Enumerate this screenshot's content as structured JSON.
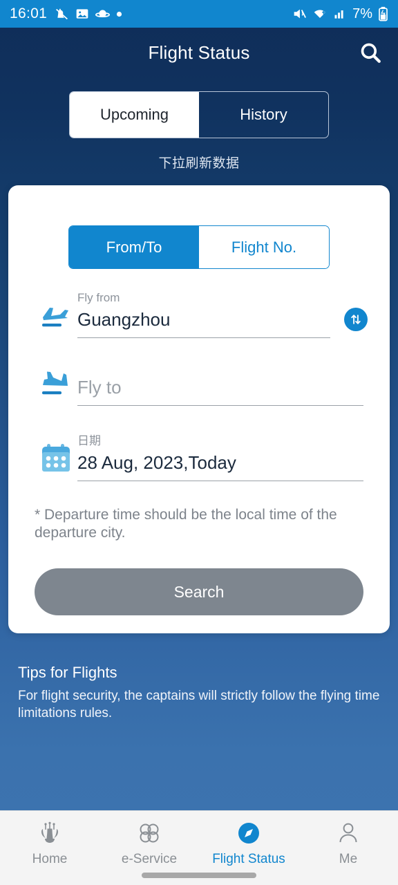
{
  "status_bar": {
    "time": "16:01",
    "battery": "7%",
    "left_icons": [
      "mute-bell-icon",
      "image-icon",
      "saturn-icon",
      "dot-icon"
    ],
    "right_icons": [
      "volume-mute-icon",
      "wifi-icon",
      "cellular-signal-icon",
      "battery-icon"
    ]
  },
  "app_bar": {
    "title": "Flight Status",
    "search_icon": "search-icon"
  },
  "segmented": {
    "items": [
      {
        "label": "Upcoming",
        "active": true
      },
      {
        "label": "History",
        "active": false
      }
    ]
  },
  "pull_hint": "下拉刷新数据",
  "card": {
    "tabs": [
      {
        "label": "From/To",
        "active": true
      },
      {
        "label": "Flight No.",
        "active": false
      }
    ],
    "from": {
      "label": "Fly from",
      "value": "Guangzhou",
      "icon": "plane-departure-icon"
    },
    "swap": {
      "icon": "swap-vertical-icon"
    },
    "to": {
      "placeholder": "Fly to",
      "value": "",
      "icon": "plane-arrival-icon"
    },
    "date": {
      "label": "日期",
      "value": "28 Aug, 2023,Today",
      "icon": "calendar-icon"
    },
    "note": "* Departure time should be the local time of the departure city.",
    "search_button": {
      "label": "Search",
      "enabled": false
    }
  },
  "tips": {
    "title": "Tips for Flights",
    "body": "For flight security, the captains will strictly follow the flying time limitations rules."
  },
  "bottom_nav": [
    {
      "label": "Home",
      "icon": "kapok-flower-icon",
      "active": false
    },
    {
      "label": "e-Service",
      "icon": "four-petals-icon",
      "active": false
    },
    {
      "label": "Flight Status",
      "icon": "compass-icon",
      "active": true
    },
    {
      "label": "Me",
      "icon": "person-icon",
      "active": false
    }
  ],
  "colors": {
    "brand_blue": "#1186ce",
    "status_bar_blue": "#1186ce",
    "header_navy": "#0f2d58",
    "disabled_gray": "#7e868f",
    "card_white": "#ffffff"
  }
}
